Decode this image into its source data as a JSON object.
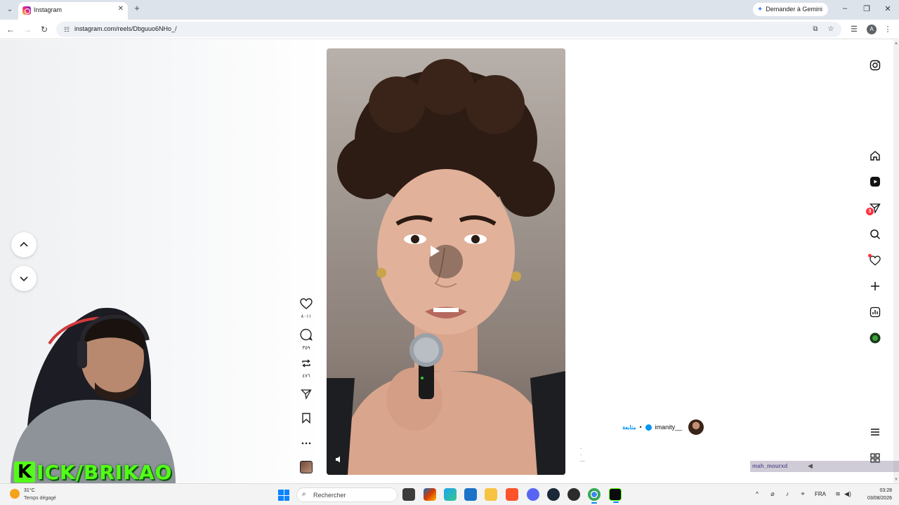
{
  "browser": {
    "tab_title": "Instagram",
    "url": "instagram.com/reels/Dbguuo6NHo_/",
    "gemini_label": "Demander à Gemini",
    "profile_initial": "A"
  },
  "reels": {
    "actions": {
      "like_count": "٨٠١١",
      "comment_count": "٣٥٩",
      "repost_count": "٤٧٦"
    },
    "author": {
      "username": "imanity__",
      "follow_label": "متابعة",
      "separator": "•"
    },
    "caption_dots": ".\n.\n..."
  },
  "sidebar": {
    "messages_badge": "3"
  },
  "overlays": {
    "kick_letter": "K",
    "kick_text": "ICK/BRIKAO",
    "chat_name": "mah_mourxd"
  },
  "taskbar": {
    "temperature": "31°C",
    "weather_desc": "Temps dégagé",
    "search_placeholder": "Rechercher",
    "language": "FRA",
    "time": "03:28",
    "date": "03/08/2026"
  },
  "colors": {
    "accent": "#0095f6",
    "notification": "#ff3040",
    "kick_green": "#53fc18"
  }
}
